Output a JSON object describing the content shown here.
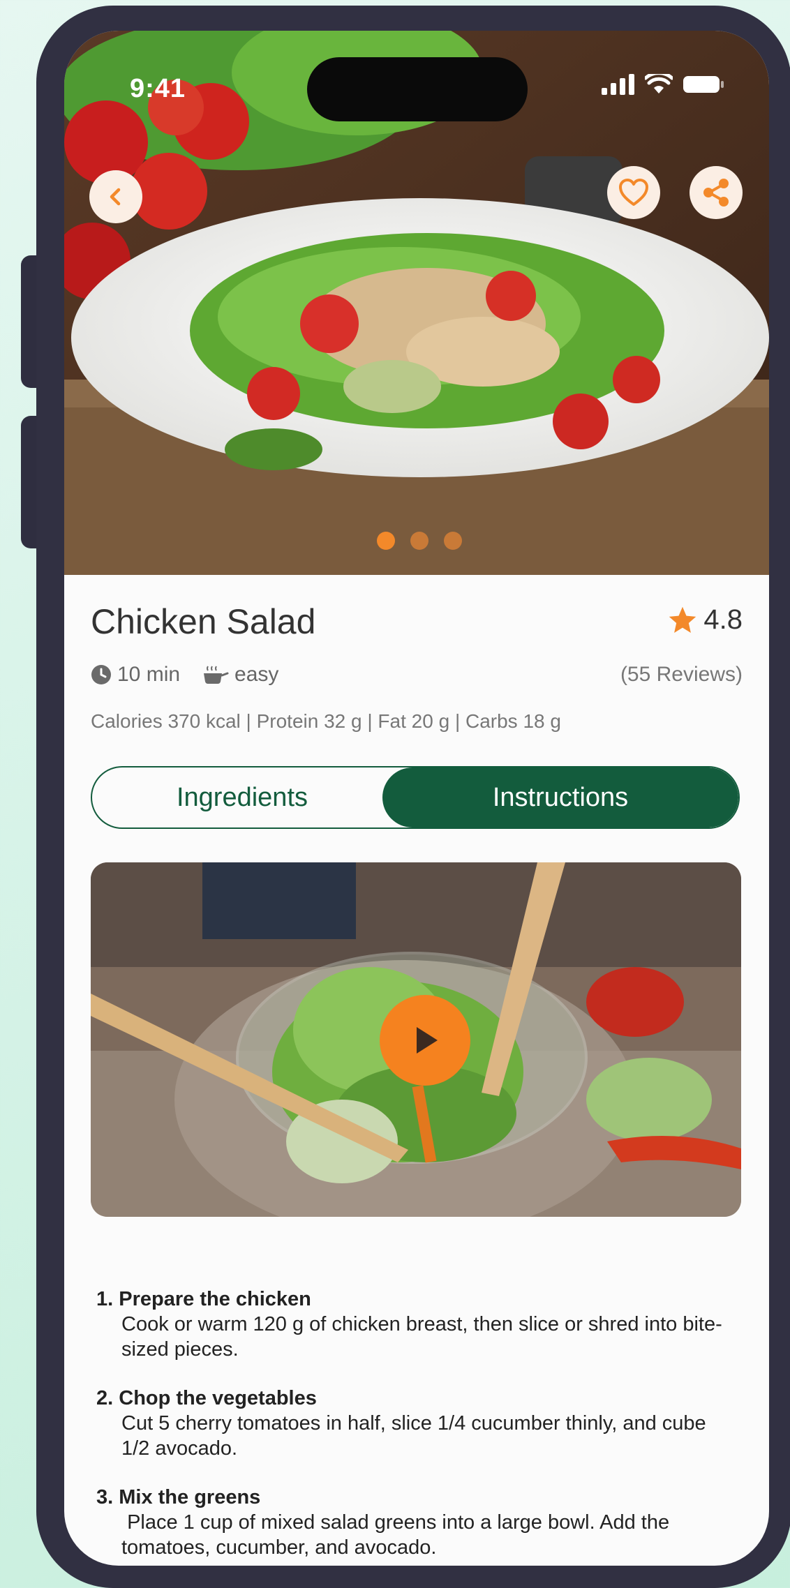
{
  "status_bar": {
    "time": "9:41"
  },
  "recipe": {
    "title": "Chicken Salad",
    "rating": "4.8",
    "reviews": "(55 Reviews)",
    "time": "10 min",
    "difficulty": "easy",
    "nutrition": "Calories 370 kcal | Protein 32 g | Fat 20 g | Carbs 18 g"
  },
  "tabs": [
    {
      "label": "Ingredients",
      "active": false
    },
    {
      "label": "Instructions",
      "active": true
    }
  ],
  "carousel": {
    "count": 3,
    "active": 0
  },
  "steps": [
    {
      "number": "1.",
      "title": "Prepare the chicken",
      "text": "Cook or warm 120 g of chicken breast, then slice or shred into bite-sized pieces."
    },
    {
      "number": "2.",
      "title": "Chop the vegetables",
      "text": "Cut 5 cherry tomatoes in half, slice 1/4 cucumber thinly, and cube 1/2 avocado."
    },
    {
      "number": "3.",
      "title": "Mix the greens",
      "text": " Place 1 cup of mixed salad greens into a large bowl. Add the tomatoes, cucumber, and avocado."
    }
  ],
  "colors": {
    "accent": "#f3892a",
    "primary": "#135c3d",
    "frame": "#313042"
  },
  "icons": [
    "back-icon",
    "heart-icon",
    "share-icon",
    "clock-icon",
    "cooking-pot-icon",
    "star-icon",
    "play-icon",
    "signal-icon",
    "wifi-icon",
    "battery-icon"
  ]
}
